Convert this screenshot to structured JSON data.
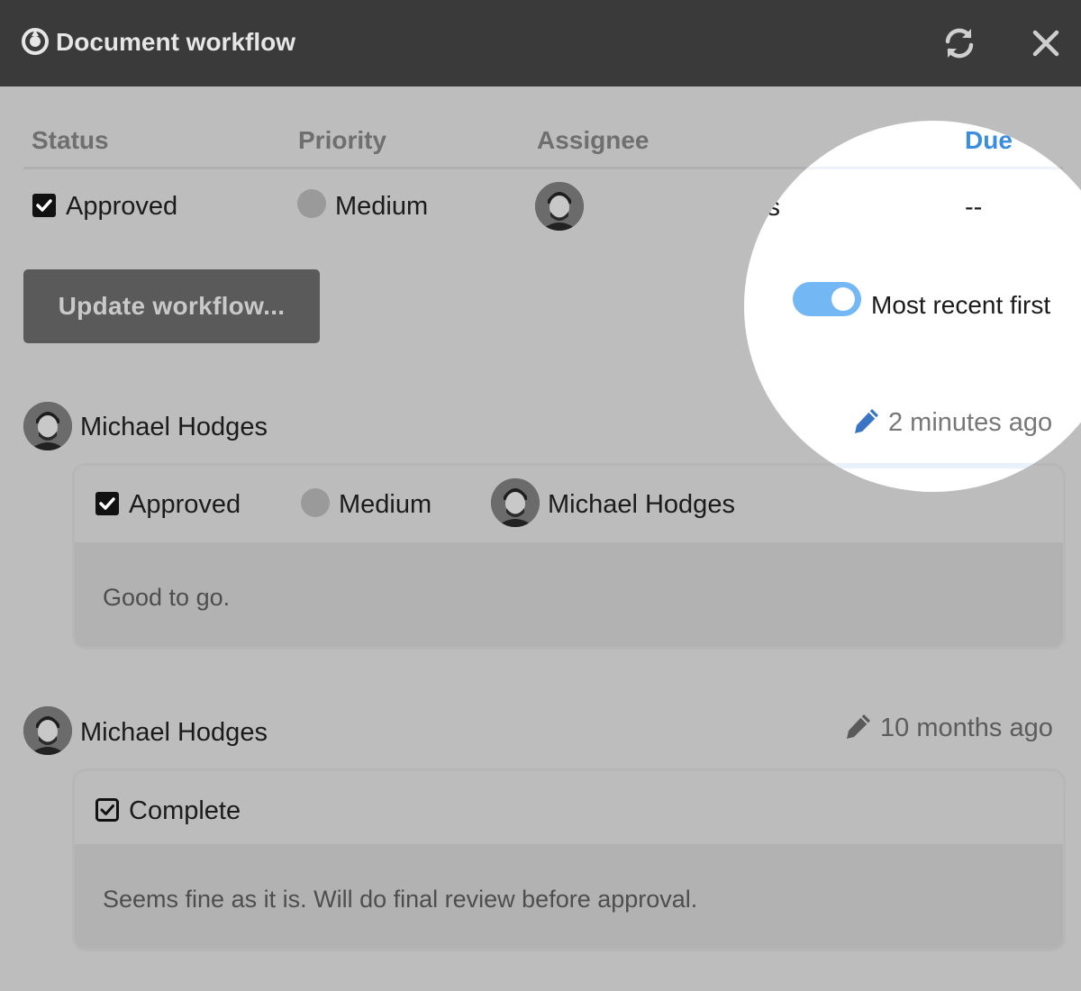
{
  "window": {
    "title": "Document workflow",
    "icons": [
      "workflow-logo-icon",
      "refresh-icon",
      "close-icon"
    ]
  },
  "table": {
    "headers": {
      "status": "Status",
      "priority": "Priority",
      "assignee": "Assignee",
      "due": "Due"
    },
    "row": {
      "status": "Approved",
      "priority": "Medium",
      "assignee": "Michael Hodges",
      "due": "--"
    }
  },
  "actions": {
    "update_label": "Update workflow..."
  },
  "sort_toggle": {
    "label": "Most recent first",
    "on": true
  },
  "history": [
    {
      "author": "Michael Hodges",
      "time": "2 minutes ago",
      "status": "Approved",
      "priority": "Medium",
      "assignee": "Michael Hodges",
      "comment": "Good to go."
    },
    {
      "author": "Michael Hodges",
      "time": "10 months ago",
      "status": "Complete",
      "comment": "Seems fine as it is. Will do final review before approval."
    }
  ],
  "colors": {
    "titlebar": "#3a3a3a",
    "overlay": "#bdbdbd",
    "accent": "#3a8de0",
    "toggle_on": "#73b7f5",
    "spotlight": "#ffffff"
  }
}
